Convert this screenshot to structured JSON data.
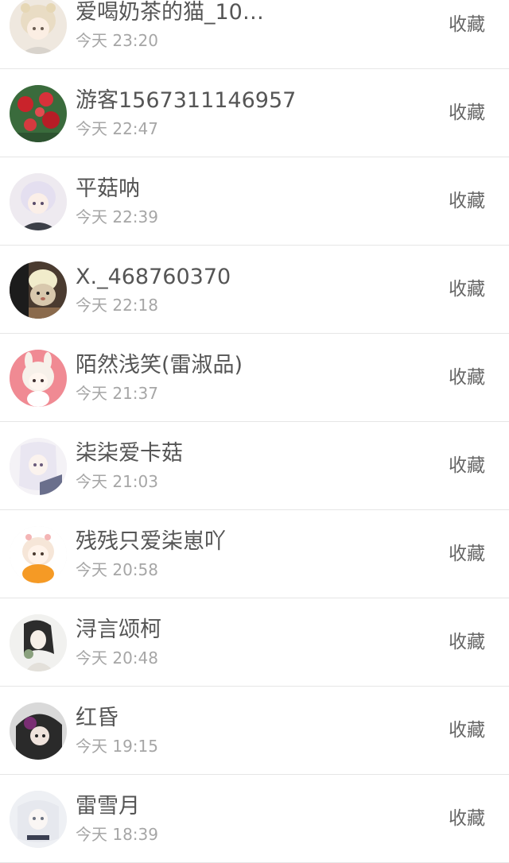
{
  "action_label": "收藏",
  "entries": [
    {
      "name": "爱喝奶茶的猫_10…",
      "time": "今天 23:20",
      "avatar": "anime-girl-white-hair-avatar"
    },
    {
      "name": "游客1567311146957",
      "time": "今天 22:47",
      "avatar": "red-flowers-avatar"
    },
    {
      "name": "平菇呐",
      "time": "今天 22:39",
      "avatar": "anime-white-hair-avatar"
    },
    {
      "name": "X._468760370",
      "time": "今天 22:18",
      "avatar": "cat-photo-avatar"
    },
    {
      "name": "陌然浅笑(雷淑品)",
      "time": "今天 21:37",
      "avatar": "chibi-pink-hood-avatar"
    },
    {
      "name": "柒柒爱卡菇",
      "time": "今天 21:03",
      "avatar": "anime-silver-hair-avatar"
    },
    {
      "name": "残残只爱柒崽吖",
      "time": "今天 20:58",
      "avatar": "chibi-orange-avatar"
    },
    {
      "name": "浔言颂柯",
      "time": "今天 20:48",
      "avatar": "ink-painting-girl-avatar"
    },
    {
      "name": "红昏",
      "time": "今天 19:15",
      "avatar": "dark-hair-purple-avatar"
    },
    {
      "name": "雷雪月",
      "time": "今天 18:39",
      "avatar": "white-hair-sketch-avatar"
    }
  ]
}
